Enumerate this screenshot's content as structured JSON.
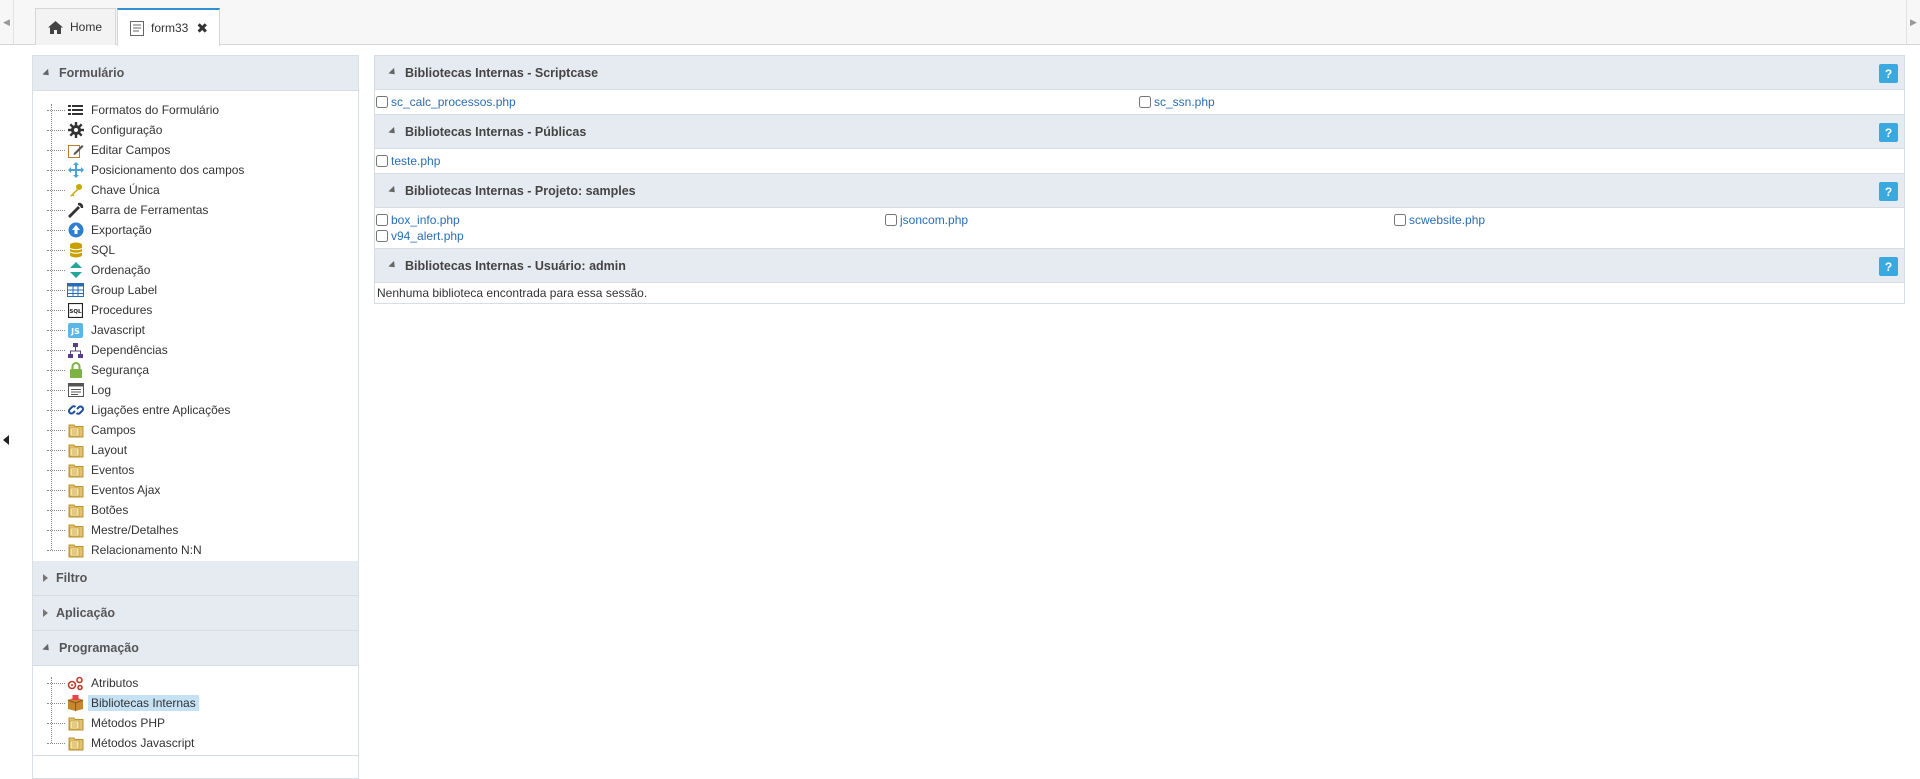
{
  "tabs": [
    {
      "label": "Home",
      "icon": "home-icon"
    },
    {
      "label": "form33",
      "icon": "form-icon",
      "close": "✖"
    }
  ],
  "sidebar": {
    "sections": [
      {
        "title": "Formulário",
        "state": "expanded"
      },
      {
        "title": "Filtro",
        "state": "collapsed"
      },
      {
        "title": "Aplicação",
        "state": "collapsed"
      },
      {
        "title": "Programação",
        "state": "expanded"
      }
    ],
    "formulario_items": [
      {
        "label": "Formatos do Formulário",
        "icon": "list-format-icon"
      },
      {
        "label": "Configuração",
        "icon": "gear-icon"
      },
      {
        "label": "Editar Campos",
        "icon": "edit-fields-icon"
      },
      {
        "label": "Posicionamento dos campos",
        "icon": "move-arrows-icon"
      },
      {
        "label": "Chave Única",
        "icon": "key-icon"
      },
      {
        "label": "Barra de Ferramentas",
        "icon": "wrench-icon"
      },
      {
        "label": "Exportação",
        "icon": "export-icon"
      },
      {
        "label": "SQL",
        "icon": "database-icon"
      },
      {
        "label": "Ordenação",
        "icon": "sort-icon"
      },
      {
        "label": "Group Label",
        "icon": "table-icon"
      },
      {
        "label": "Procedures",
        "icon": "sql-procedure-icon"
      },
      {
        "label": "Javascript",
        "icon": "javascript-icon"
      },
      {
        "label": "Dependências",
        "icon": "hierarchy-icon"
      },
      {
        "label": "Segurança",
        "icon": "lock-icon"
      },
      {
        "label": "Log",
        "icon": "log-icon"
      },
      {
        "label": "Ligações entre Aplicações",
        "icon": "link-icon"
      },
      {
        "label": "Campos",
        "icon": "folder-icon"
      },
      {
        "label": "Layout",
        "icon": "folder-icon"
      },
      {
        "label": "Eventos",
        "icon": "folder-icon"
      },
      {
        "label": "Eventos Ajax",
        "icon": "folder-icon"
      },
      {
        "label": "Botões",
        "icon": "folder-icon"
      },
      {
        "label": "Mestre/Detalhes",
        "icon": "folder-icon"
      },
      {
        "label": "Relacionamento N:N",
        "icon": "folder-icon"
      }
    ],
    "programacao_items": [
      {
        "label": "Atributos",
        "icon": "attributes-icon"
      },
      {
        "label": "Bibliotecas Internas",
        "icon": "library-box-icon",
        "selected": true
      },
      {
        "label": "Métodos PHP",
        "icon": "folder-icon"
      },
      {
        "label": "Métodos Javascript",
        "icon": "folder-icon"
      }
    ]
  },
  "libraries": [
    {
      "title": "Bibliotecas Internas - Scriptcase",
      "help": "?",
      "files": [
        "sc_calc_processos.php",
        "sc_ssn.php"
      ]
    },
    {
      "title": "Bibliotecas Internas - Públicas",
      "help": "?",
      "files": [
        "teste.php"
      ]
    },
    {
      "title": "Bibliotecas Internas - Projeto: samples",
      "help": "?",
      "files": [
        "box_info.php",
        "jsoncom.php",
        "scwebsite.php",
        "v94_alert.php"
      ]
    },
    {
      "title": "Bibliotecas Internas - Usuário: admin",
      "help": "?",
      "empty_message": "Nenhuma biblioteca encontrada para essa sessão."
    }
  ],
  "colors": {
    "accent": "#2e8fd4",
    "link": "#2a6db5",
    "help_button": "#3aa9e0",
    "header_bg": "#e6ebf1",
    "selected_bg": "#c5e2f5"
  }
}
